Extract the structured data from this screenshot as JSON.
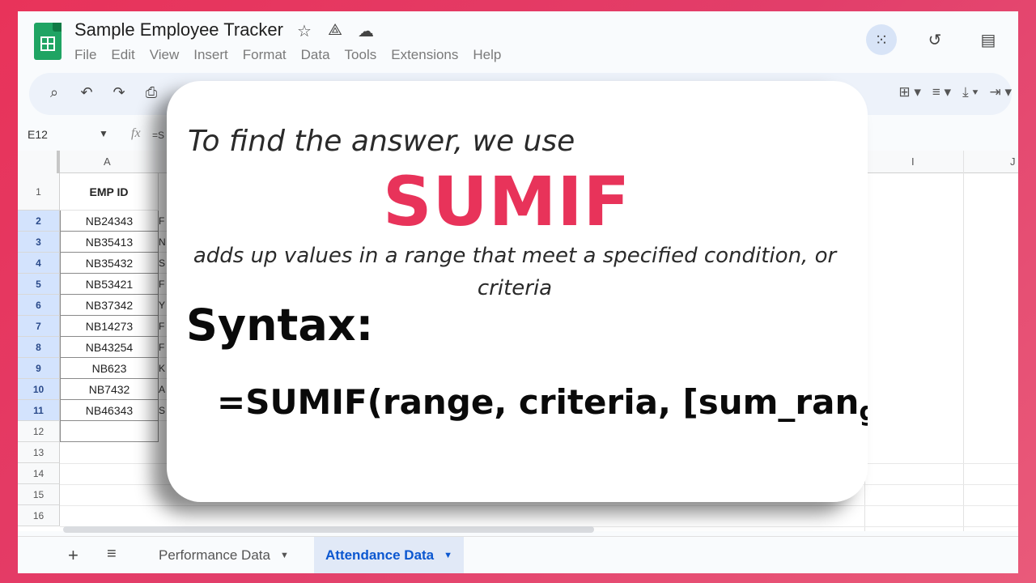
{
  "app": {
    "title": "Sample Employee Tracker",
    "menu": [
      "File",
      "Edit",
      "View",
      "Insert",
      "Format",
      "Data",
      "Tools",
      "Extensions",
      "Help"
    ],
    "title_icons": [
      "star-icon",
      "move-to-drive-icon",
      "cloud-status-icon"
    ],
    "top_right_icons": [
      "meet-icon",
      "history-icon",
      "comments-icon"
    ]
  },
  "toolbar": {
    "left_icons": [
      "search-icon",
      "undo-icon",
      "redo-icon",
      "print-icon"
    ],
    "right_icons": [
      "merge-cells-icon",
      "horizontal-align-icon",
      "vertical-align-icon",
      "text-wrap-icon"
    ]
  },
  "formula_bar": {
    "cell_ref": "E12",
    "fx": "fx",
    "formula": "=S"
  },
  "grid": {
    "columns": [
      "A",
      "I",
      "J"
    ],
    "header": {
      "row": "1",
      "value": "EMP ID"
    },
    "rows": [
      {
        "num": "2",
        "id": "NB24343",
        "b": "F"
      },
      {
        "num": "3",
        "id": "NB35413",
        "b": "N"
      },
      {
        "num": "4",
        "id": "NB35432",
        "b": "S"
      },
      {
        "num": "5",
        "id": "NB53421",
        "b": "F"
      },
      {
        "num": "6",
        "id": "NB37342",
        "b": "Y"
      },
      {
        "num": "7",
        "id": "NB14273",
        "b": "F"
      },
      {
        "num": "8",
        "id": "NB43254",
        "b": "F"
      },
      {
        "num": "9",
        "id": "NB623",
        "b": "K"
      },
      {
        "num": "10",
        "id": "NB7432",
        "b": "A"
      },
      {
        "num": "11",
        "id": "NB46343",
        "b": "S"
      }
    ],
    "empty_rows": [
      "12",
      "13",
      "14",
      "15",
      "16"
    ]
  },
  "sheets": {
    "tabs": [
      "Performance Data",
      "Attendance Data"
    ],
    "active": "Attendance Data"
  },
  "overlay": {
    "intro": "To find the answer, we use",
    "headline": "SUMIF",
    "description": "adds up values in a range that meet a specified condition, or criteria",
    "syntax_label": "Syntax:",
    "syntax_formula": "=SUMIF(range, criteria, [sum_ran",
    "syntax_tail": "g",
    "accent_color": "#e8335a"
  }
}
